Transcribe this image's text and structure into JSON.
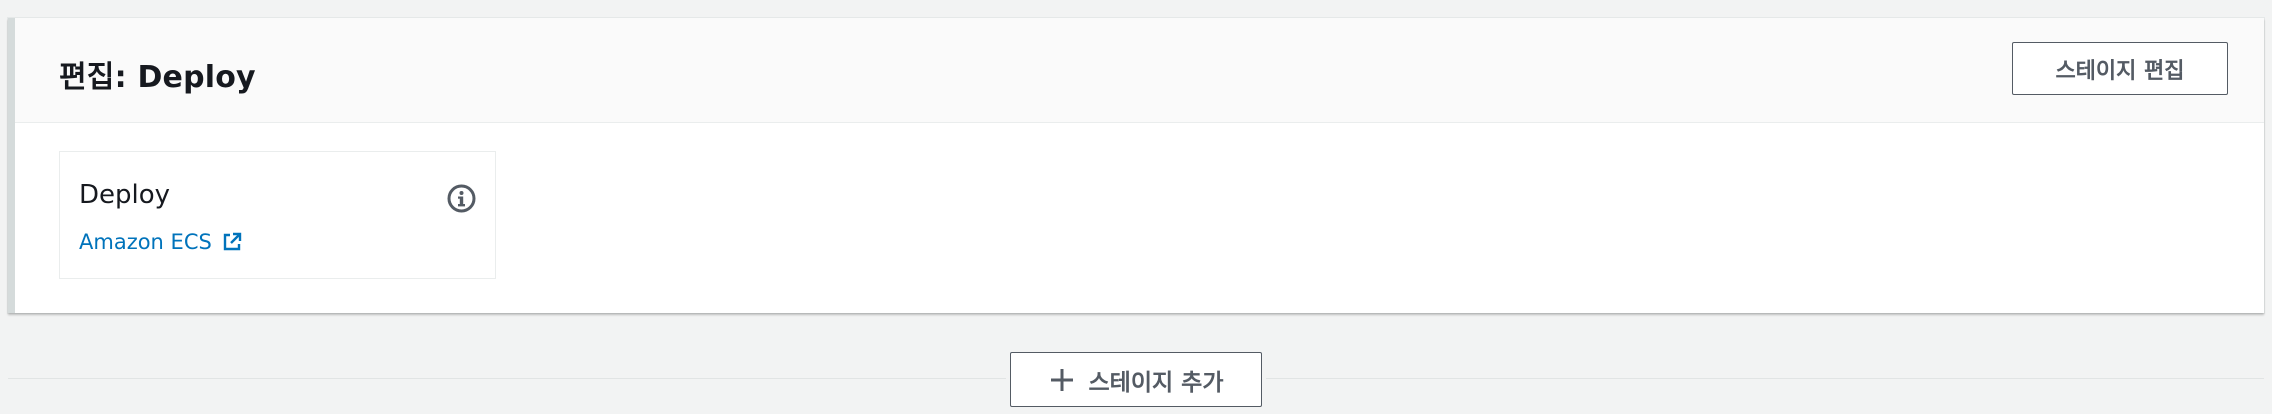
{
  "stage": {
    "title": "편집: Deploy",
    "edit_button_label": "스테이지 편집"
  },
  "action": {
    "name": "Deploy",
    "provider_label": "Amazon ECS",
    "icons": {
      "info": "info-icon",
      "external_link": "external-link-icon"
    }
  },
  "add_stage": {
    "label": "스테이지 추가",
    "icon": "plus-icon"
  },
  "colors": {
    "link": "#0073bb",
    "button_border": "#545b64",
    "panel_accent": "#d5dbdb",
    "text": "#16191f"
  }
}
